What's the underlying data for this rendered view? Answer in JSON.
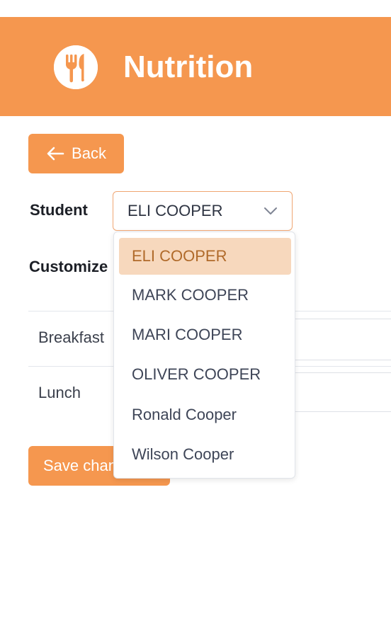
{
  "header": {
    "title": "Nutrition",
    "logo_icon": "fork-knife-icon",
    "background_color": "#f5974f"
  },
  "back_button": {
    "label": "Back",
    "icon": "arrow-left-icon"
  },
  "student_select": {
    "label": "Student",
    "selected_value": "ELI COOPER",
    "options": [
      "ELI COOPER",
      "MARK COOPER",
      "MARI COOPER",
      "OLIVER COOPER",
      "Ronald Cooper",
      "Wilson Cooper"
    ],
    "highlight_color": "#f7d8bd"
  },
  "customize": {
    "heading": "Customize"
  },
  "meals": [
    {
      "name": "Breakfast"
    },
    {
      "name": "Lunch"
    }
  ],
  "save_button": {
    "label": "Save changes"
  }
}
